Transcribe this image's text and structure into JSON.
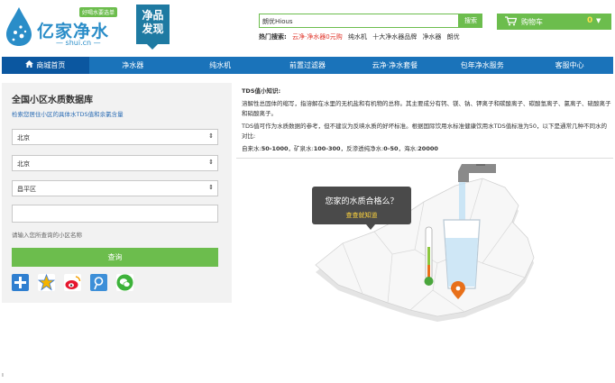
{
  "header": {
    "brand": "亿家净水",
    "domain": "— shui.cn —",
    "tagline": "好喝水要选单",
    "badge_line1": "净品",
    "badge_line2": "发现"
  },
  "search": {
    "value": "朗优Hious",
    "button": "搜索",
    "hot_label": "热门搜索:",
    "hot_links": [
      "云净·净水器0元购",
      "纯水机",
      "十大净水器品牌",
      "净水器",
      "朗优"
    ]
  },
  "cart": {
    "label": "购物车",
    "count": "0",
    "arrow": "▼"
  },
  "nav": {
    "items": [
      {
        "label": "商城首页"
      },
      {
        "label": "净水器"
      },
      {
        "label": "纯水机"
      },
      {
        "label": "前置过滤器"
      },
      {
        "label": "云净·净水套餐"
      },
      {
        "label": "包年净水服务"
      },
      {
        "label": "客服中心"
      }
    ]
  },
  "panel": {
    "title": "全国小区水质数据库",
    "subtitle": "检索您居住小区的具体水TDS值和余氯含量",
    "province": "北京",
    "city": "北京",
    "district": "昌平区",
    "hint": "请输入您所查询的小区名称",
    "query_button": "查询"
  },
  "info": {
    "title": "TDS值小知识:",
    "para1": "溶解性总固体的缩写，指溶解在水里的无机盐和有机物的总称。其主要成分有钙、镁、钠、钾离子和碳酸离子、碳酸氢离子、氯离子、硫酸离子和硝酸离子。",
    "para2": "TDS值可作为水质数据的参考，但不建议为反映水质的好坏标准。根据国际饮用水标准健康饮用水TDS值标准为50，以下是通常几种不同水的对比:",
    "compare": [
      {
        "label": "自来水:",
        "value": "50-1000"
      },
      {
        "label": "矿泉水:",
        "value": "100-300"
      },
      {
        "label": "反渗透纯净水:",
        "value": "0-50"
      },
      {
        "label": "海水:",
        "value": "20000"
      }
    ]
  },
  "map": {
    "question": "您家的水质合格么？",
    "link": "查查就知道"
  },
  "colors": {
    "nav_blue": "#1a73ba",
    "nav_active": "#0b57a0",
    "green": "#6cbd4d",
    "brand_blue": "#2a8dc8"
  }
}
